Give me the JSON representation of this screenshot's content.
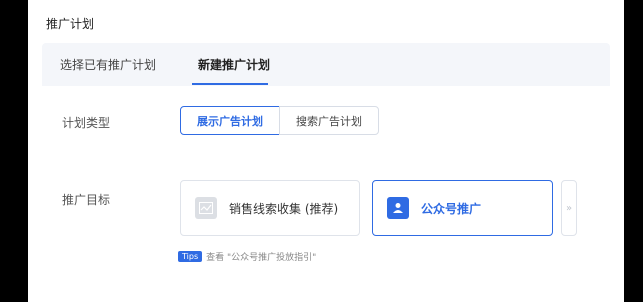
{
  "section_title": "推广计划",
  "tabs": [
    {
      "label": "选择已有推广计划",
      "active": false
    },
    {
      "label": "新建推广计划",
      "active": true
    }
  ],
  "plan_type": {
    "label": "计划类型",
    "options": [
      {
        "label": "展示广告计划",
        "selected": true
      },
      {
        "label": "搜索广告计划",
        "selected": false
      }
    ]
  },
  "goal": {
    "label": "推广目标",
    "options": [
      {
        "label": "销售线索收集 (推荐)",
        "icon": "leads-form-icon",
        "selected": false
      },
      {
        "label": "公众号推广",
        "icon": "official-account-icon",
        "selected": true
      }
    ],
    "more_icon": "double-chevron-right-icon"
  },
  "tips": {
    "badge": "Tips",
    "text": "查看 \"公众号推广投放指引\""
  },
  "colors": {
    "accent": "#2f6be3",
    "tab_bg": "#f4f6fa",
    "border": "#dfe3ea",
    "frame": "#000000"
  }
}
